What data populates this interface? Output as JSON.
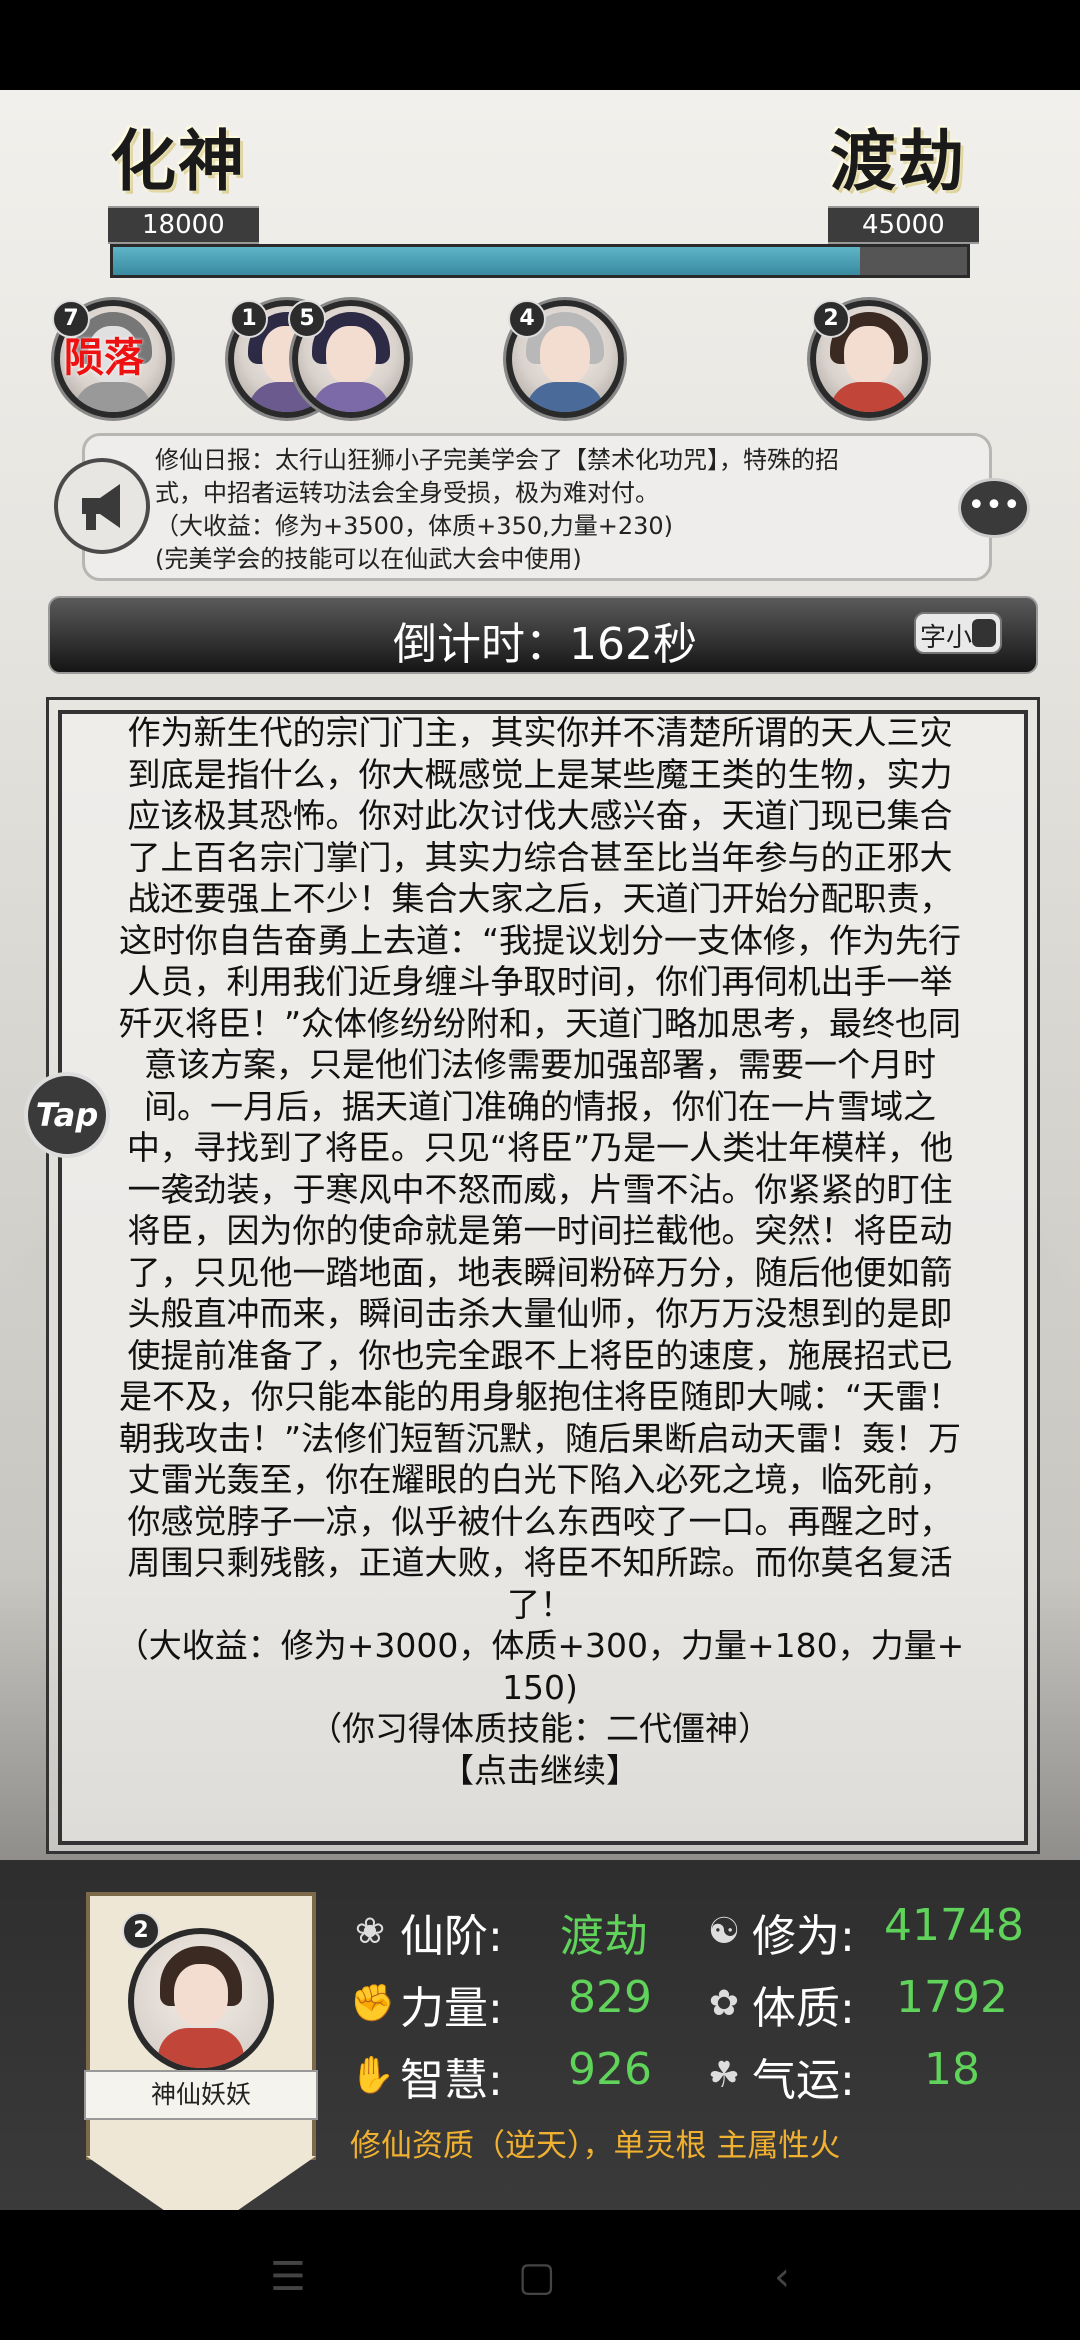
{
  "realm": {
    "current": {
      "name": "化神",
      "value": "18000"
    },
    "next": {
      "name": "渡劫",
      "value": "45000"
    },
    "progress_fraction": 0.875
  },
  "avatars": [
    {
      "badge": "7",
      "status": "陨落"
    },
    {
      "badge": "1"
    },
    {
      "badge": "5"
    },
    {
      "badge": "4"
    },
    {
      "badge": "2"
    }
  ],
  "news": {
    "lines": [
      "修仙日报：太行山狂狮小子完美学会了【禁术化功咒】，特殊的招",
      "式，中招者运转功法会全身受损，极为难对付。",
      "（大收益：修为+3500，体质+350,力量+230)",
      "(完美学会的技能可以在仙武大会中使用)"
    ],
    "horn_icon": "megaphone-icon",
    "chat_icon": "chat-bubble-icon"
  },
  "countdown": {
    "text": "倒计时：162秒",
    "font_toggle_label": "字小"
  },
  "story": {
    "lines": [
      "作为新生代的宗门门主，其实你并不清楚所谓的天人三灾",
      "到底是指什么，你大概感觉上是某些魔王类的生物，实力",
      "应该极其恐怖。你对此次讨伐大感兴奋，天道门现已集合",
      "了上百名宗门掌门，其实力综合甚至比当年参与的正邪大",
      "战还要强上不少！集合大家之后，天道门开始分配职责，",
      "这时你自告奋勇上去道：“我提议划分一支体修，作为先行",
      "人员，利用我们近身缠斗争取时间，你们再伺机出手一举",
      "歼灭将臣！”众体修纷纷附和，天道门略加思考，最终也同",
      "意该方案，只是他们法修需要加强部署，需要一个月时",
      "间。一月后，据天道门准确的情报，你们在一片雪域之",
      "中，寻找到了将臣。只见“将臣”乃是一人类壮年模样，他",
      "一袭劲装，于寒风中不怒而威，片雪不沾。你紧紧的盯住",
      "将臣，因为你的使命就是第一时间拦截他。突然！将臣动",
      "了，只见他一踏地面，地表瞬间粉碎万分，随后他便如箭",
      "头般直冲而来，瞬间击杀大量仙师，你万万没想到的是即",
      "使提前准备了，你也完全跟不上将臣的速度，施展招式已",
      "是不及，你只能本能的用身躯抱住将臣随即大喊：“天雷！",
      "朝我攻击！”法修们短暂沉默，随后果断启动天雷！轰！万",
      "丈雷光轰至，你在耀眼的白光下陷入必死之境，临死前，",
      "你感觉脖子一凉，似乎被什么东西咬了一口。再醒之时，",
      "周围只剩残骸，正道大败，将臣不知所踪。而你莫名复活",
      "了！",
      "（大收益：修为+3000，体质+300，力量+180，力量+",
      "150)",
      "（你习得体质技能：二代僵神）",
      "【点击继续】"
    ],
    "tap_label": "Tap"
  },
  "character": {
    "badge": "2",
    "name": "神仙妖妖",
    "stats": [
      {
        "icon": "lotus-icon",
        "label": "仙阶:",
        "value": "渡劫"
      },
      {
        "icon": "swirl-icon",
        "label": "修为:",
        "value": "41748"
      },
      {
        "icon": "fist-icon",
        "label": "力量:",
        "value": "829"
      },
      {
        "icon": "leaf-icon",
        "label": "体质:",
        "value": "1792"
      },
      {
        "icon": "hand-icon",
        "label": "智慧:",
        "value": "926"
      },
      {
        "icon": "clover-icon",
        "label": "气运:",
        "value": "18"
      }
    ],
    "aptitude": "修仙资质（逆天），单灵根 主属性火"
  },
  "colors": {
    "stat_value": "#5fd35a",
    "aptitude": "#f0b030",
    "progress": "#4a9db2",
    "fallen": "#e11111"
  }
}
